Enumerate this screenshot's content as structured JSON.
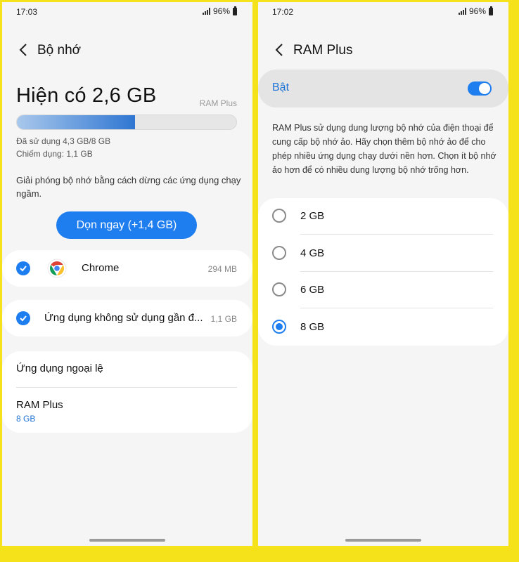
{
  "left": {
    "status": {
      "time": "17:03",
      "battery": "96%"
    },
    "header": {
      "title": "Bộ nhớ"
    },
    "available": "Hiện có 2,6 GB",
    "ram_plus_label": "RAM Plus",
    "memory_used_fraction": 0.5375,
    "used_text": "Đã sử dụng 4,3 GB/8 GB",
    "occupied_text": "Chiếm dụng: 1,1 GB",
    "description": "Giải phóng bộ nhớ bằng cách dừng các ứng dụng chạy ngầm.",
    "clean_button": "Dọn ngay (+1,4 GB)",
    "apps": [
      {
        "name": "Chrome",
        "size": "294 MB",
        "icon": "chrome-icon",
        "checked": true
      },
      {
        "name": "Ứng dụng không sử dụng gần đ...",
        "size": "1,1 GB",
        "checked": true
      }
    ],
    "options": [
      {
        "label": "Ứng dụng ngoại lệ"
      },
      {
        "label": "RAM Plus",
        "sub": "8 GB"
      }
    ]
  },
  "right": {
    "status": {
      "time": "17:02",
      "battery": "96%"
    },
    "header": {
      "title": "RAM Plus"
    },
    "toggle": {
      "label": "Bật",
      "on": true
    },
    "description": "RAM Plus sử dụng dung lượng bộ nhớ của điện thoại để cung cấp bộ nhớ ảo. Hãy chọn thêm bộ nhớ ảo để cho phép nhiều ứng dụng chạy dưới nền hơn. Chọn ít bộ nhớ ảo hơn để có nhiều dung lượng bộ nhớ trống hơn.",
    "options": [
      "2 GB",
      "4 GB",
      "6 GB",
      "8 GB"
    ],
    "selected": "8 GB"
  },
  "colors": {
    "accent": "#1e7ef0",
    "frame": "#f5e21a",
    "link": "#1e74d6"
  }
}
